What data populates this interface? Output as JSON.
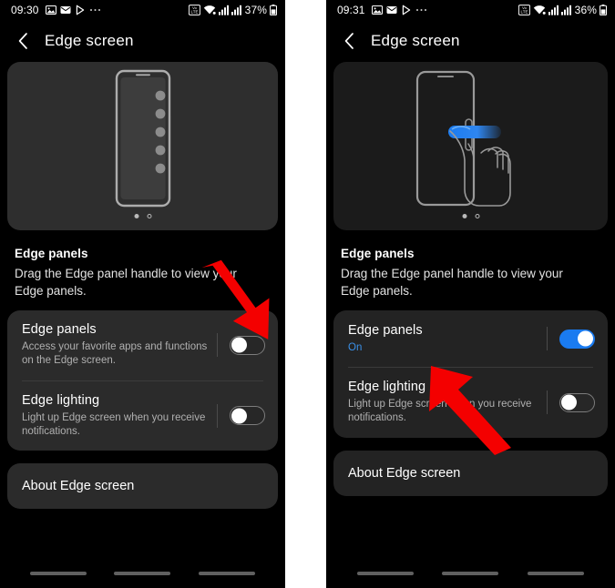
{
  "panels": [
    {
      "key": "before",
      "statusbar": {
        "time": "09:30",
        "left_icons": [
          "image-icon",
          "email-icon",
          "play-store-icon",
          "overflow-icon"
        ],
        "right_icons": [
          "volte-icon",
          "wifi-icon",
          "signal-sim1-icon",
          "signal-sim2-icon",
          "battery-icon"
        ],
        "battery_percent": "37%"
      },
      "titlebar": {
        "back_icon": "back-chevron-icon",
        "title": "Edge screen"
      },
      "illustration": {
        "type": "phone-with-edge-panel-dots",
        "page_indicator": {
          "current": 1,
          "total": 2
        }
      },
      "section": {
        "title": "Edge panels",
        "description": "Drag the Edge panel handle to view your Edge panels."
      },
      "rows": [
        {
          "title": "Edge panels",
          "subtitle": "Access your favorite apps and functions on the Edge screen.",
          "subtitle_highlight": false,
          "toggle": "off"
        },
        {
          "title": "Edge lighting",
          "subtitle": "Light up Edge screen when you receive notifications.",
          "subtitle_highlight": false,
          "toggle": "off"
        }
      ],
      "about": "About Edge screen"
    },
    {
      "key": "after",
      "statusbar": {
        "time": "09:31",
        "left_icons": [
          "image-icon",
          "email-icon",
          "play-store-icon",
          "overflow-icon"
        ],
        "right_icons": [
          "volte-icon",
          "wifi-icon",
          "signal-sim1-icon",
          "signal-sim2-icon",
          "battery-icon"
        ],
        "battery_percent": "36%"
      },
      "titlebar": {
        "back_icon": "back-chevron-icon",
        "title": "Edge screen"
      },
      "illustration": {
        "type": "phone-with-hand-dragging-edge-handle",
        "page_indicator": {
          "current": 1,
          "total": 2
        }
      },
      "section": {
        "title": "Edge panels",
        "description": "Drag the Edge panel handle to view your Edge panels."
      },
      "rows": [
        {
          "title": "Edge panels",
          "subtitle": "On",
          "subtitle_highlight": true,
          "toggle": "on"
        },
        {
          "title": "Edge lighting",
          "subtitle": "Light up Edge screen when you receive notifications.",
          "subtitle_highlight": false,
          "toggle": "off"
        }
      ],
      "about": "About Edge screen"
    }
  ],
  "annotations": [
    {
      "name": "arrow-pointing-to-edge-panels-toggle",
      "direction": "down-right",
      "color": "#f40000"
    },
    {
      "name": "arrow-pointing-to-edge-panels-on-state",
      "direction": "up-left",
      "color": "#f40000"
    }
  ],
  "colors": {
    "background": "#000000",
    "card": "#2b2b2b",
    "card_alt": "#232323",
    "accent_blue": "#1a7bf0",
    "subtitle_blue": "#3a90e8",
    "arrow_red": "#f40000",
    "text_primary": "#ffffff",
    "text_secondary": "#b0b0b0"
  }
}
